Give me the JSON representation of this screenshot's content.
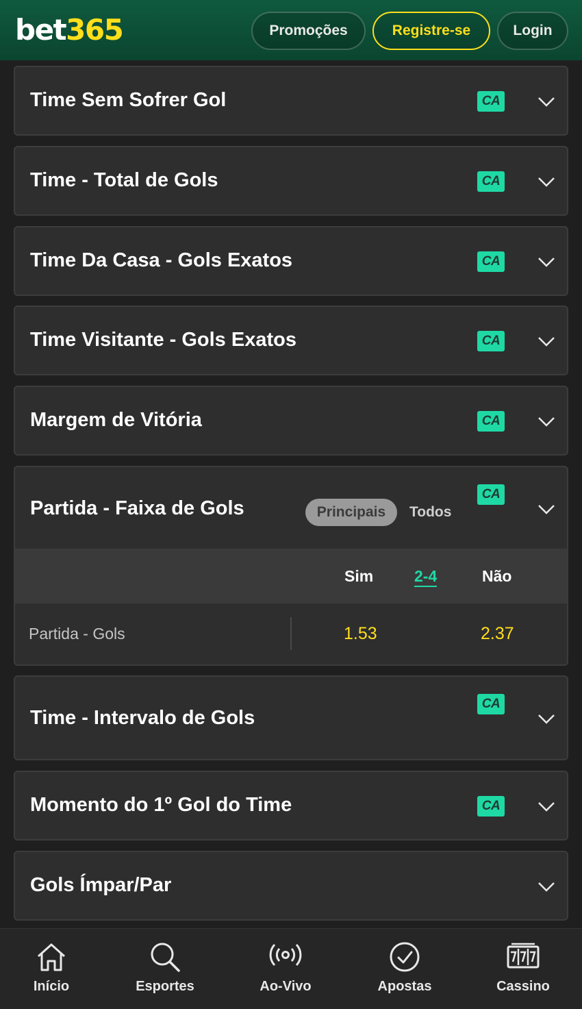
{
  "header": {
    "logo_part1": "bet",
    "logo_part2": "365",
    "promo_label": "Promoções",
    "register_label": "Registre-se",
    "login_label": "Login"
  },
  "badge_text": "CA",
  "markets": [
    {
      "title": "Time Sem Sofrer Gol",
      "has_badge": true
    },
    {
      "title": "Time - Total de Gols",
      "has_badge": true
    },
    {
      "title": "Time Da Casa - Gols Exatos",
      "has_badge": true
    },
    {
      "title": "Time Visitante - Gols Exatos",
      "has_badge": true
    },
    {
      "title": "Margem de Vitória",
      "has_badge": true
    },
    {
      "title": "Partida - Faixa de Gols",
      "has_badge": true,
      "expanded": true
    },
    {
      "title": "Time - Intervalo de Gols",
      "has_badge": true
    },
    {
      "title": "Momento do 1º Gol do Time",
      "has_badge": true
    },
    {
      "title": "Gols Ímpar/Par",
      "has_badge": false
    }
  ],
  "expanded_market": {
    "tab_principais": "Principais",
    "tab_todos": "Todos",
    "col_sim": "Sim",
    "col_range": "2-4",
    "col_nao": "Não",
    "row_label": "Partida - Gols",
    "odd_sim": "1.53",
    "odd_nao": "2.37"
  },
  "bottom_nav": [
    {
      "label": "Início",
      "icon": "home-icon"
    },
    {
      "label": "Esportes",
      "icon": "search-icon"
    },
    {
      "label": "Ao-Vivo",
      "icon": "live-broadcast-icon"
    },
    {
      "label": "Apostas",
      "icon": "check-circle-icon"
    },
    {
      "label": "Cassino",
      "icon": "slot-machine-icon"
    }
  ],
  "colors": {
    "header_green": "#0f5a3f",
    "brand_yellow": "#ffdf1b",
    "badge_green": "#1fd9a5",
    "card_bg": "#2e2e2e"
  }
}
